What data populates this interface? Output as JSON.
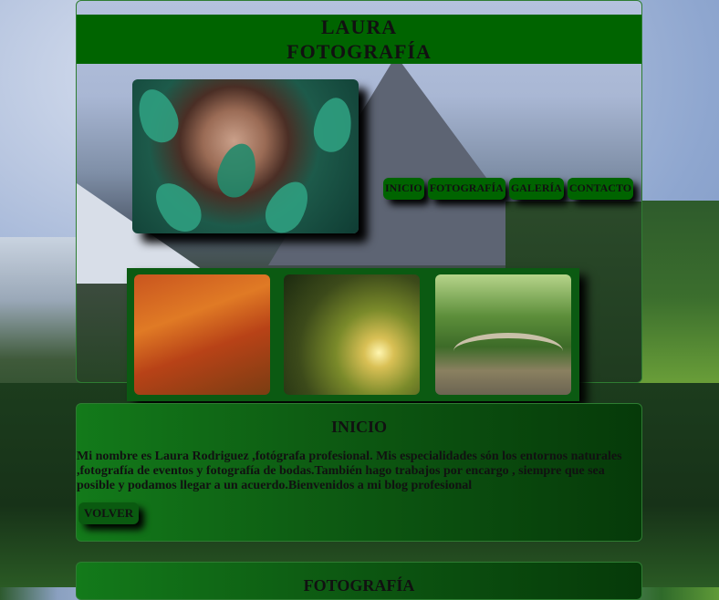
{
  "header": {
    "title_line1": "LAURA",
    "title_line2": "FOTOGRAFÍA"
  },
  "nav": {
    "items": [
      "INICIO",
      "FOTOGRAFÍA",
      "GALERÍA",
      "CONTACTO"
    ]
  },
  "sections": [
    {
      "title": "INICIO",
      "text": "Mi nombre es Laura Rodriguez ,fotógrafa profesional. Mis especialidades són los entornos naturales ,fotografía de eventos y fotografía de bodas.También hago trabajos por encargo , siempre que sea posible y podamos llegar a un acuerdo.Bienvenidos a mi blog profesional",
      "button": "VOLVER"
    },
    {
      "title": "FOTOGRAFÍA"
    }
  ],
  "colors": {
    "accent": "#006400"
  }
}
